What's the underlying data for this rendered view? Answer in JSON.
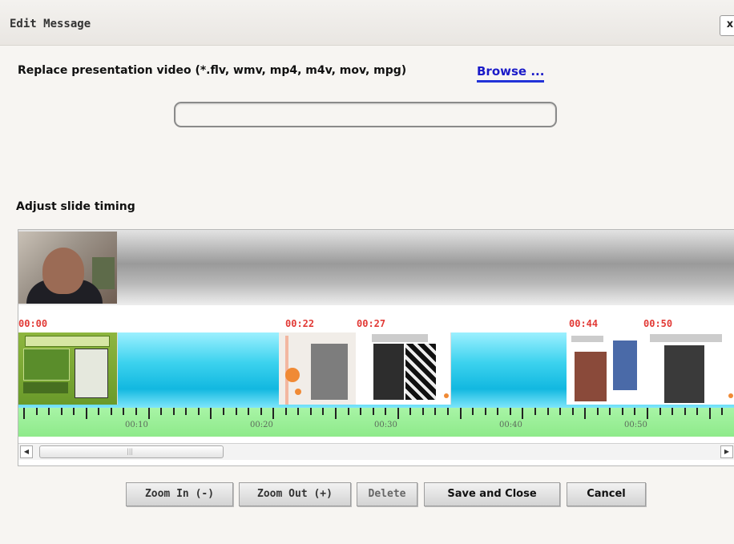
{
  "dialog": {
    "title": "Edit Message",
    "close_label": "x"
  },
  "upload": {
    "label": "Replace presentation video (*.flv, wmv, mp4, m4v, mov, mpg)",
    "browse_label": "Browse ...",
    "file_value": ""
  },
  "timing": {
    "heading": "Adjust slide timing",
    "slide_times": [
      "00:00",
      "00:22",
      "00:27",
      "00:44",
      "00:50"
    ],
    "ruler_labels": [
      "00:10",
      "00:20",
      "00:30",
      "00:40",
      "00:50"
    ],
    "scroll_left_icon": "left-arrow-icon",
    "scroll_right_icon": "right-arrow-icon",
    "scroll_thumb_grip": "|||"
  },
  "buttons": {
    "zoom_in": "Zoom In (-)",
    "zoom_out": "Zoom Out (+)",
    "delete": "Delete",
    "save_close": "Save and Close",
    "cancel": "Cancel"
  },
  "colors": {
    "link": "#1a1ac8",
    "time_label": "#e23a36",
    "slide_band": "#12b8e0",
    "ruler": "#8eea8a"
  }
}
